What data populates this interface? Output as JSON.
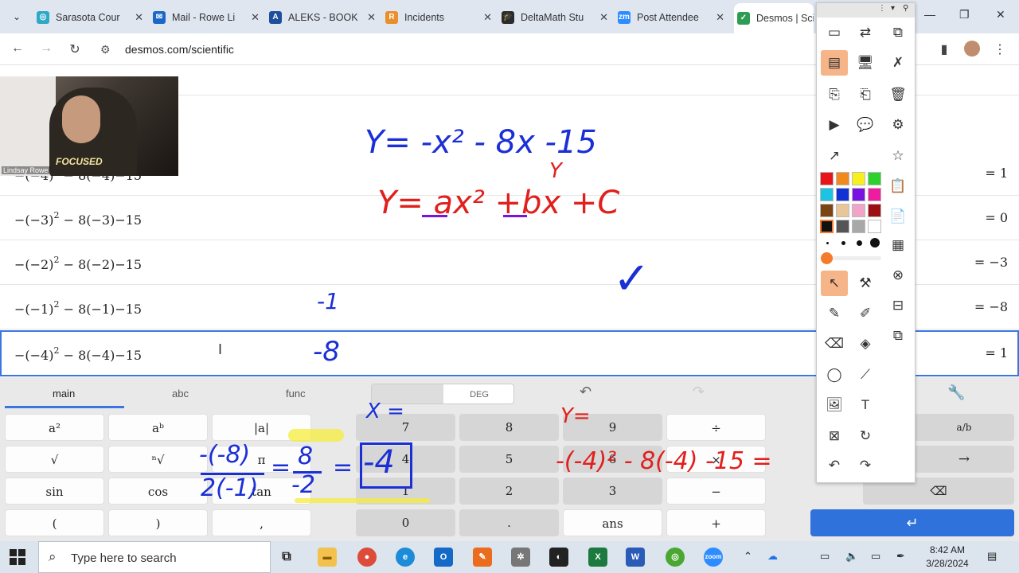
{
  "browser": {
    "tabs": [
      {
        "title": "Sarasota Cour",
        "fav_color": "#2ea8c7",
        "fav_glyph": "◎"
      },
      {
        "title": "Mail - Rowe Li",
        "fav_color": "#1a66c9",
        "fav_glyph": "✉"
      },
      {
        "title": "ALEKS - BOOK",
        "fav_color": "#1e4f9c",
        "fav_glyph": "A"
      },
      {
        "title": "Incidents",
        "fav_color": "#e98f2b",
        "fav_glyph": "R"
      },
      {
        "title": "DeltaMath Stu",
        "fav_color": "#2b2b2b",
        "fav_glyph": "🎓"
      },
      {
        "title": "Post Attendee",
        "fav_color": "#2d8cff",
        "fav_glyph": "zm"
      },
      {
        "title": "Desmos | Scie",
        "fav_color": "#2e9c51",
        "fav_glyph": "✓"
      }
    ],
    "url": "desmos.com/scientific"
  },
  "webcam": {
    "name": "Lindsay Rowe",
    "shirt_text": "FOCUSED"
  },
  "expressions": [
    {
      "expr_prefix": "−(−4)",
      "exp": "2",
      "expr_suffix": " − 8(−4)−15",
      "result": "= 1"
    },
    {
      "expr_prefix": "−(−3)",
      "exp": "2",
      "expr_suffix": " − 8(−3)−15",
      "result": "= 0"
    },
    {
      "expr_prefix": "−(−2)",
      "exp": "2",
      "expr_suffix": " − 8(−2)−15",
      "result": "= −3"
    },
    {
      "expr_prefix": "−(−1)",
      "exp": "2",
      "expr_suffix": " − 8(−1)−15",
      "result": "= −8"
    },
    {
      "expr_prefix": "−(−4)",
      "exp": "2",
      "expr_suffix": " − 8(−4)−15",
      "result": "= 1"
    }
  ],
  "keypad": {
    "tabs": [
      "main",
      "abc",
      "func"
    ],
    "deg_label": "DEG",
    "left_keys": [
      "a²",
      "aᵇ",
      "|a|",
      "√",
      "ⁿ√",
      "π",
      "sin",
      "cos",
      "tan",
      "(",
      ")",
      ","
    ],
    "num_keys": [
      "7",
      "8",
      "9",
      "÷",
      "4",
      "5",
      "6",
      "×",
      "1",
      "2",
      "3",
      "−",
      "0",
      ".",
      "ans",
      "+"
    ],
    "frac_key": "a/b",
    "arrow_key": "→",
    "backspace": "⌫",
    "enter": "↵"
  },
  "taskbar": {
    "search_placeholder": "Type here to search",
    "time": "8:42 AM",
    "date": "3/28/2024"
  },
  "ink": {
    "blue_eq": "Y= -x² - 8x -15",
    "red_y": "Y",
    "red_eq": "Y= ax² +bx +C",
    "blue_neg1": "-1",
    "blue_neg8": "-8",
    "blue_check": "✓",
    "blue_xeq": "X =",
    "red_yeq": "Y=",
    "blue_frac_num": "-(-8)",
    "blue_frac_den": "2(-1)",
    "blue_eq_sign": "=",
    "blue_frac2_num": "8",
    "blue_frac2_den": "-2",
    "blue_eq_sign2": "=",
    "blue_answer": "-4",
    "red_eval": "-(-4)² - 8(-4) -15 ="
  },
  "colors": {
    "accent": "#3b76e0",
    "enter": "#2f72dc",
    "ink_blue": "#1b2fd6",
    "ink_red": "#e0201c",
    "highlight_yellow": "#f5ec3a",
    "tool_highlight": "#f6b489"
  },
  "anno_colors": [
    "#e8141a",
    "#f2891e",
    "#f7f01e",
    "#2ed12c",
    "#1cc3e3",
    "#1131d6",
    "#7a13e0",
    "#ef1ca0",
    "#7a4512",
    "#e8c69a",
    "#f1a3c8",
    "#9c0d14",
    "#111111",
    "#555555",
    "#a8a8a8",
    "#ffffff"
  ]
}
